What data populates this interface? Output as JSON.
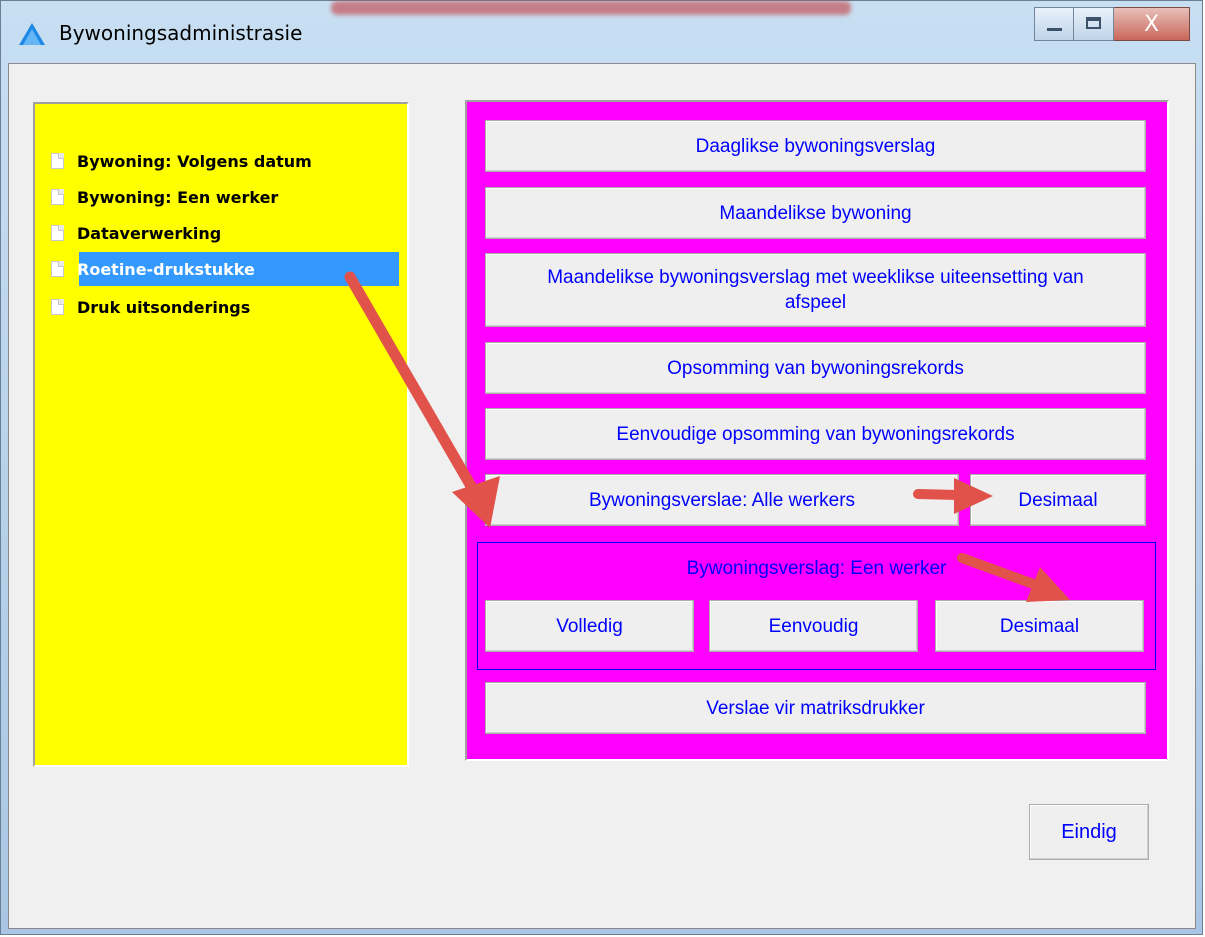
{
  "window": {
    "title": "Bywoningsadministrasie",
    "controls": {
      "close_glyph": "X"
    }
  },
  "tree": {
    "items": [
      {
        "label": "Bywoning: Volgens datum",
        "selected": false
      },
      {
        "label": "Bywoning: Een werker",
        "selected": false
      },
      {
        "label": "Dataverwerking",
        "selected": false
      },
      {
        "label": "Roetine-drukstukke",
        "selected": true
      },
      {
        "label": "Druk uitsonderings",
        "selected": false
      }
    ]
  },
  "panel": {
    "daily_report": "Daaglikse bywoningsverslag",
    "monthly_attendance": "Maandelikse bywoning",
    "monthly_weekly": "Maandelikse bywoningsverslag met weeklikse uiteensetting van afspeel",
    "summary": "Opsomming van bywoningsrekords",
    "simple_summary": "Eenvoudige opsomming van bywoningsrekords",
    "all_workers": "Bywoningsverslae: Alle werkers",
    "all_workers_decimal": "Desimaal",
    "one_worker_group": "Bywoningsverslag: Een werker",
    "full": "Volledig",
    "simple": "Eenvoudig",
    "decimal": "Desimaal",
    "matrix": "Verslae vir matriksdrukker"
  },
  "footer": {
    "end_button": "Eindig"
  },
  "colors": {
    "tree_bg": "#ffff00",
    "panel_bg": "#ff00ff",
    "button_text": "#0000ff",
    "selection": "#3399ff",
    "annotation_arrow": "#e0524a"
  }
}
